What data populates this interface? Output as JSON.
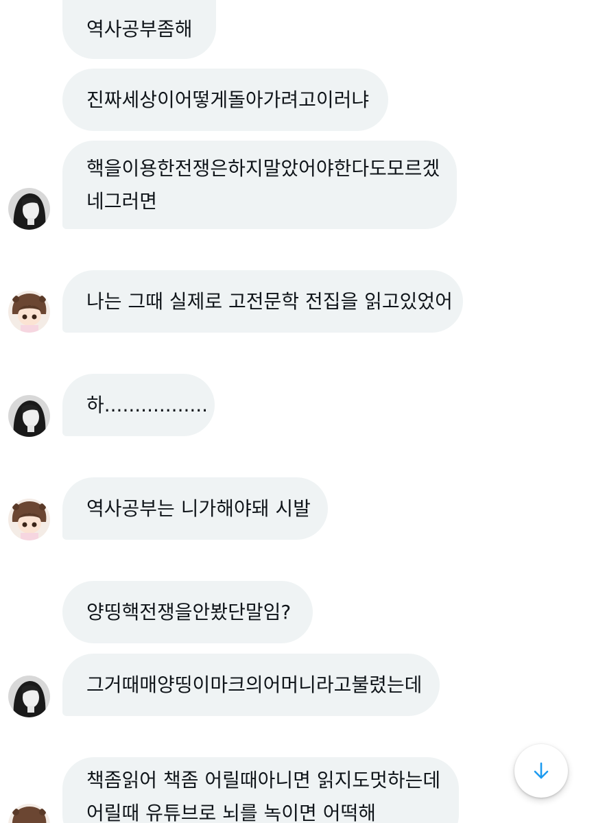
{
  "messages": [
    {
      "lines": [
        "역사공부좀해"
      ]
    },
    {
      "lines": [
        "진짜세상이어떻게돌아가려고이러냐"
      ]
    },
    {
      "lines": [
        "핵을이용한전쟁은하지말았어야한다도모르겠",
        "네그러면"
      ]
    },
    {
      "lines": [
        "나는 그때 실제로 고전문학 전집을 읽고있었어"
      ]
    },
    {
      "lines": [
        "하................."
      ]
    },
    {
      "lines": [
        "역사공부는 니가해야돼 시발"
      ]
    },
    {
      "lines": [
        "양띵핵전쟁을안봤단말임?"
      ]
    },
    {
      "lines": [
        "그거때매양띵이마크의어머니라고불렸는데"
      ]
    },
    {
      "lines": [
        "책좀읽어 책좀 어릴때아니면 읽지도멋하는데",
        "어릴때 유튜브로 뇌를 녹이면 어떡해"
      ]
    }
  ],
  "icons": {
    "scroll_down": "arrow-down-icon"
  },
  "colors": {
    "bubble_bg": "#eff3f4",
    "text": "#0f1419",
    "accent": "#1d9bf0"
  }
}
